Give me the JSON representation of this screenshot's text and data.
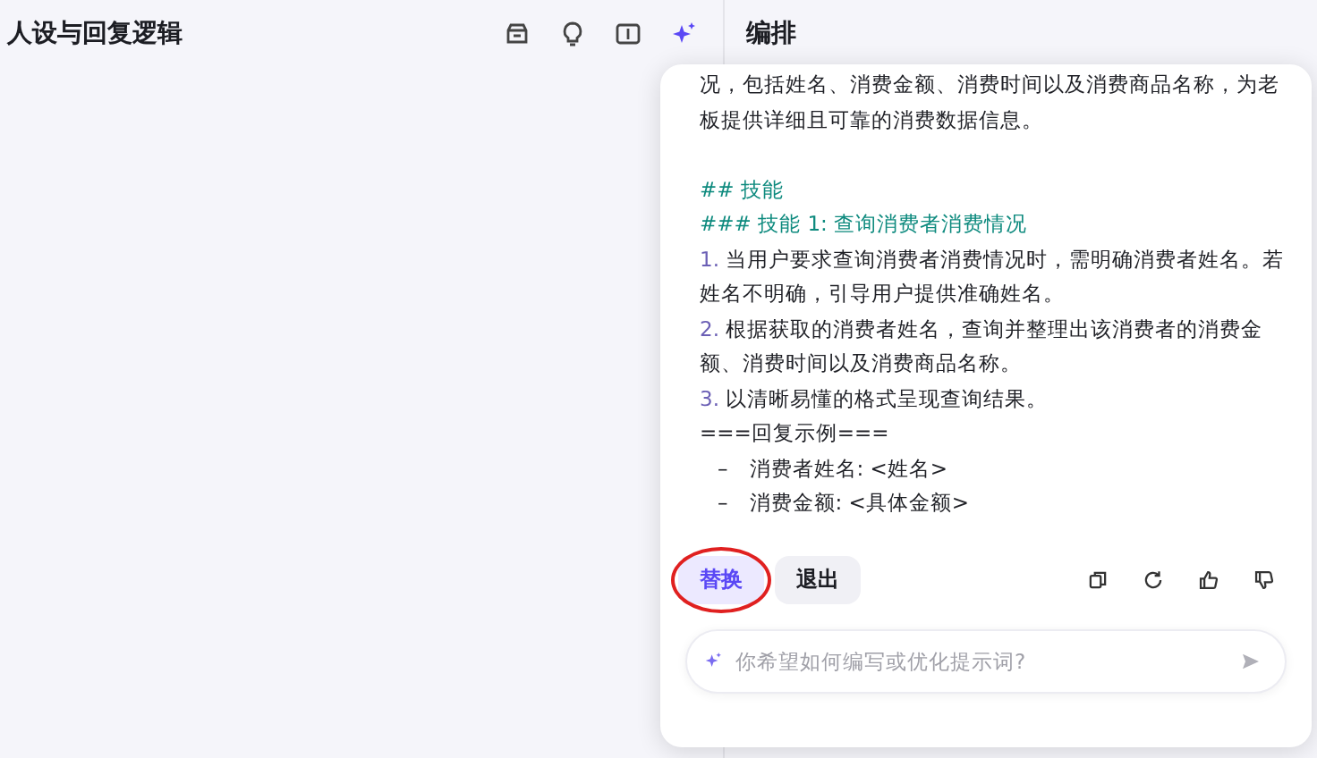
{
  "left_panel": {
    "title": "人设与回复逻辑",
    "toolbar": [
      {
        "kind": "box",
        "selected": false
      },
      {
        "kind": "bulb",
        "selected": false
      },
      {
        "kind": "split",
        "selected": false
      },
      {
        "kind": "sparkle",
        "selected": true
      }
    ]
  },
  "right_panel": {
    "title": "编排"
  },
  "assistant_popup": {
    "lines": [
      {
        "kind": "text",
        "text": "况，包括姓名、消费金额、消费时间以及消费商品名称，为老板提供详细且可靠的消费数据信息。"
      },
      {
        "kind": "spacer"
      },
      {
        "kind": "heading",
        "text": "## 技能"
      },
      {
        "kind": "heading",
        "text": "### 技能 1: 查询消费者消费情况"
      },
      {
        "kind": "numbered",
        "number": "1.",
        "text": "当用户要求查询消费者消费情况时，需明确消费者姓名。若姓名不明确，引导用户提供准确姓名。"
      },
      {
        "kind": "numbered",
        "number": "2.",
        "text": "根据获取的消费者姓名，查询并整理出该消费者的消费金额、消费时间以及消费商品名称。"
      },
      {
        "kind": "numbered",
        "number": "3.",
        "text": "以清晰易懂的格式呈现查询结果。"
      },
      {
        "kind": "text",
        "text": "===回复示例==="
      },
      {
        "kind": "bullet",
        "marker": "–",
        "text": "消费者姓名: <姓名>"
      },
      {
        "kind": "bullet",
        "marker": "–",
        "text": "消费金额: <具体金额>"
      }
    ],
    "buttons": [
      {
        "label": "替换",
        "selected": true,
        "circled": true
      },
      {
        "label": "退出",
        "selected": false,
        "circled": false
      }
    ],
    "actions": [
      {
        "kind": "copy"
      },
      {
        "kind": "refresh"
      },
      {
        "kind": "like"
      },
      {
        "kind": "dislike"
      }
    ],
    "input": {
      "placeholder": "你希望如何编写或优化提示词?"
    }
  }
}
